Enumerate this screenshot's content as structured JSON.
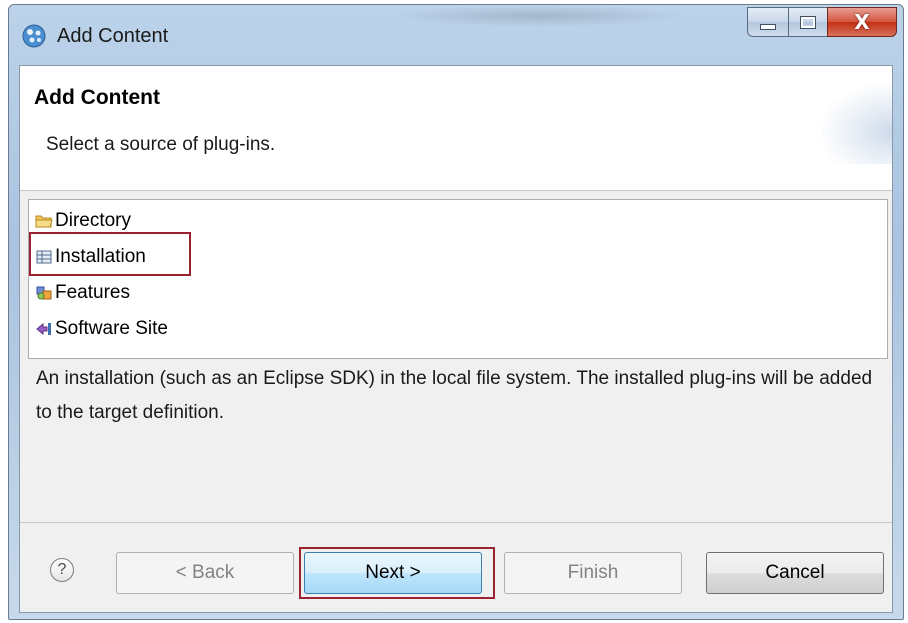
{
  "window": {
    "title": "Add Content",
    "app_icon": "eclipse-globe-icon",
    "minimize_icon": "minimize-icon",
    "maximize_icon": "maximize-icon",
    "close_glyph": "X"
  },
  "page": {
    "title": "Add Content",
    "description": "Select a source of plug-ins."
  },
  "sources": [
    {
      "label": "Directory",
      "icon": "folder-icon",
      "selected": false
    },
    {
      "label": "Installation",
      "icon": "installation-icon",
      "selected": true
    },
    {
      "label": "Features",
      "icon": "features-icon",
      "selected": false
    },
    {
      "label": "Software Site",
      "icon": "software-site-icon",
      "selected": false
    }
  ],
  "selection_description": "An installation (such as an Eclipse SDK) in the local file system. The installed plug-ins will be added to the target definition.",
  "buttons": {
    "help": "?",
    "back": "< Back",
    "next": "Next >",
    "finish": "Finish",
    "cancel": "Cancel"
  },
  "colors": {
    "highlight": "#9b2230",
    "default_button": "#bee6fd"
  }
}
